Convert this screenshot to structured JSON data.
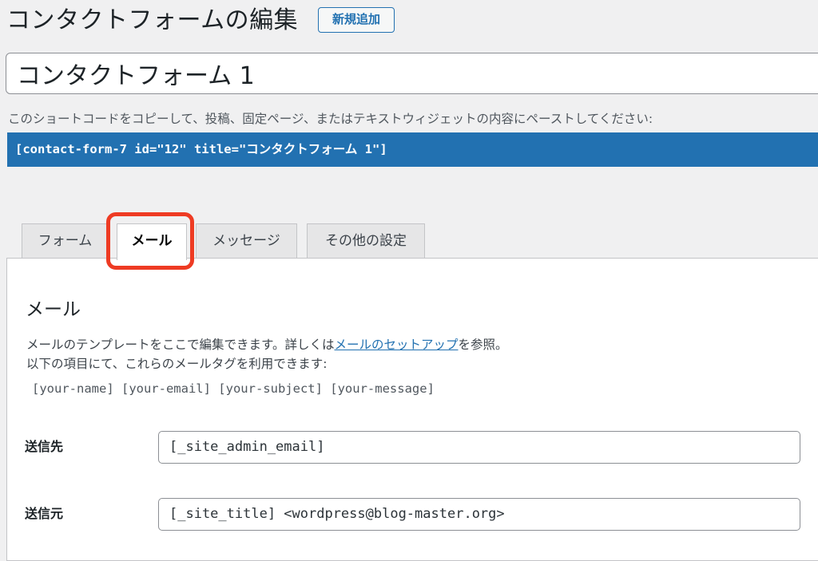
{
  "header": {
    "title": "コンタクトフォームの編集",
    "add_new_label": "新規追加"
  },
  "form_title_value": "コンタクトフォーム 1",
  "shortcode": {
    "hint": "このショートコードをコピーして、投稿、固定ページ、またはテキストウィジェットの内容にペーストしてください:",
    "code": "[contact-form-7 id=\"12\" title=\"コンタクトフォーム 1\"]",
    "background_color": "#2271b1"
  },
  "tabs": [
    {
      "label": "フォーム",
      "active": false
    },
    {
      "label": "メール",
      "active": true
    },
    {
      "label": "メッセージ",
      "active": false
    },
    {
      "label": "その他の設定",
      "active": false
    }
  ],
  "highlight_color": "#ee3b23",
  "mail_panel": {
    "title": "メール",
    "desc_before_link": "メールのテンプレートをここで編集できます。詳しくは",
    "link_text": "メールのセットアップ",
    "desc_after_link": "を参照。",
    "desc_line2": "以下の項目にて、これらのメールタグを利用できます:",
    "mail_tags": "[your-name] [your-email] [your-subject] [your-message]",
    "fields": [
      {
        "label": "送信先",
        "value": "[_site_admin_email]"
      },
      {
        "label": "送信元",
        "value": "[_site_title] <wordpress@blog-master.org>"
      }
    ]
  }
}
